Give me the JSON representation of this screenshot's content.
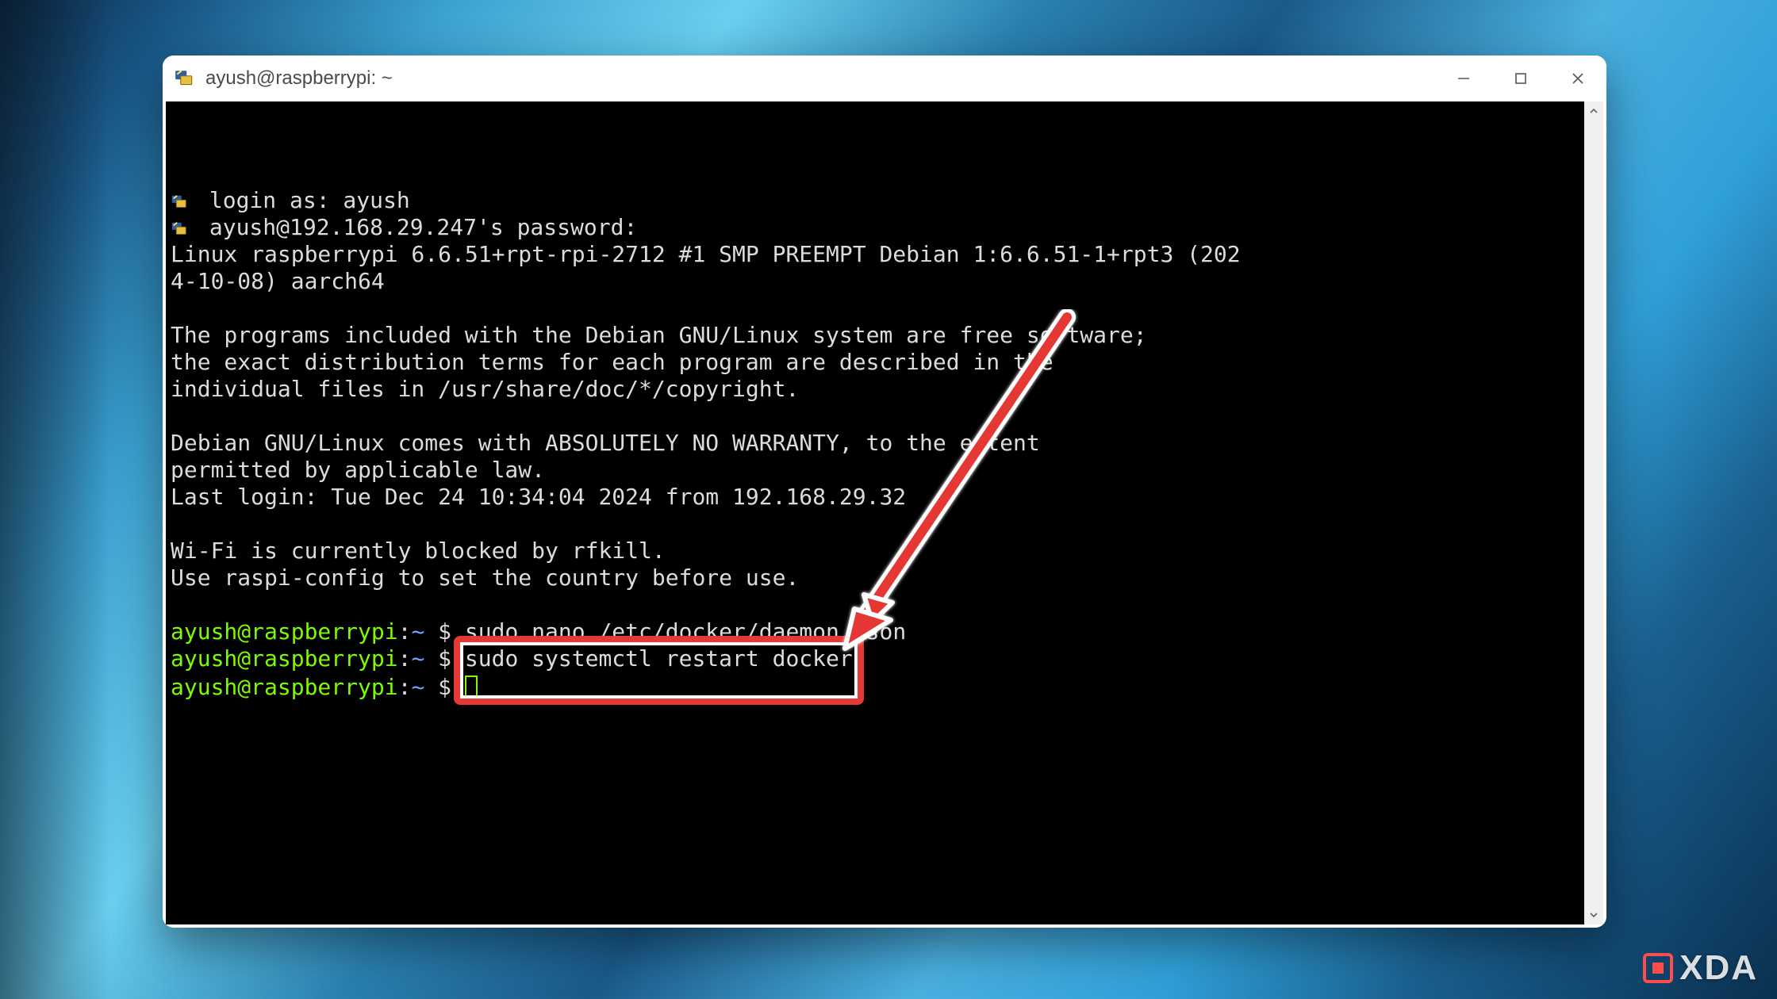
{
  "window": {
    "title": "ayush@raspberrypi: ~"
  },
  "terminal": {
    "login_line": "login as: ayush",
    "password_line": "ayush@192.168.29.247's password:",
    "kernel_line1": "Linux raspberrypi 6.6.51+rpt-rpi-2712 #1 SMP PREEMPT Debian 1:6.6.51-1+rpt3 (202",
    "kernel_line2": "4-10-08) aarch64",
    "motd_line1": "The programs included with the Debian GNU/Linux system are free software;",
    "motd_line2": "the exact distribution terms for each program are described in the",
    "motd_line3": "individual files in /usr/share/doc/*/copyright.",
    "warranty_line1": "Debian GNU/Linux comes with ABSOLUTELY NO WARRANTY, to the extent",
    "warranty_line2": "permitted by applicable law.",
    "last_login": "Last login: Tue Dec 24 10:34:04 2024 from 192.168.29.32",
    "wifi_line1": "Wi-Fi is currently blocked by rfkill.",
    "wifi_line2": "Use raspi-config to set the country before use.",
    "prompt_host": "ayush@raspberrypi",
    "prompt_sep": ":",
    "prompt_path": "~",
    "prompt_symbol": "$",
    "commands": [
      "sudo nano /etc/docker/daemon.json",
      "sudo systemctl restart docker",
      ""
    ],
    "highlighted_command_index": 1
  },
  "watermark": {
    "text": "XDA"
  },
  "annotation": {
    "highlight_color": "#e53935"
  }
}
